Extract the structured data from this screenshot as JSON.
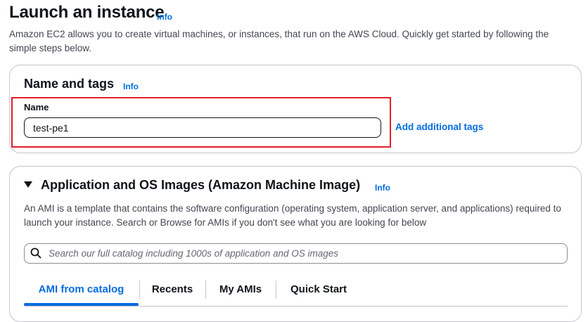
{
  "page": {
    "title": "Launch an instance",
    "info_label": "Info",
    "description": "Amazon EC2 allows you to create virtual machines, or instances, that run on the AWS Cloud. Quickly get started by following the simple steps below."
  },
  "name_and_tags": {
    "title": "Name and tags",
    "info_label": "Info",
    "name_label": "Name",
    "name_value": "test-pe1",
    "add_tags_label": "Add additional tags"
  },
  "ami": {
    "title": "Application and OS Images (Amazon Machine Image)",
    "info_label": "Info",
    "expanded": true,
    "description": "An AMI is a template that contains the software configuration (operating system, application server, and applications) required to launch your instance. Search or Browse for AMIs if you don't see what you are looking for below",
    "search_placeholder": "Search our full catalog including 1000s of application and OS images",
    "tabs": [
      {
        "label": "AMI from catalog",
        "active": true
      },
      {
        "label": "Recents",
        "active": false
      },
      {
        "label": "My AMIs",
        "active": false
      },
      {
        "label": "Quick Start",
        "active": false
      }
    ]
  },
  "colors": {
    "accent": "#006ce0",
    "highlight": "#e01e2a",
    "text": "#0f141a",
    "secondary_text": "#424650",
    "border": "#c6c6cd"
  }
}
